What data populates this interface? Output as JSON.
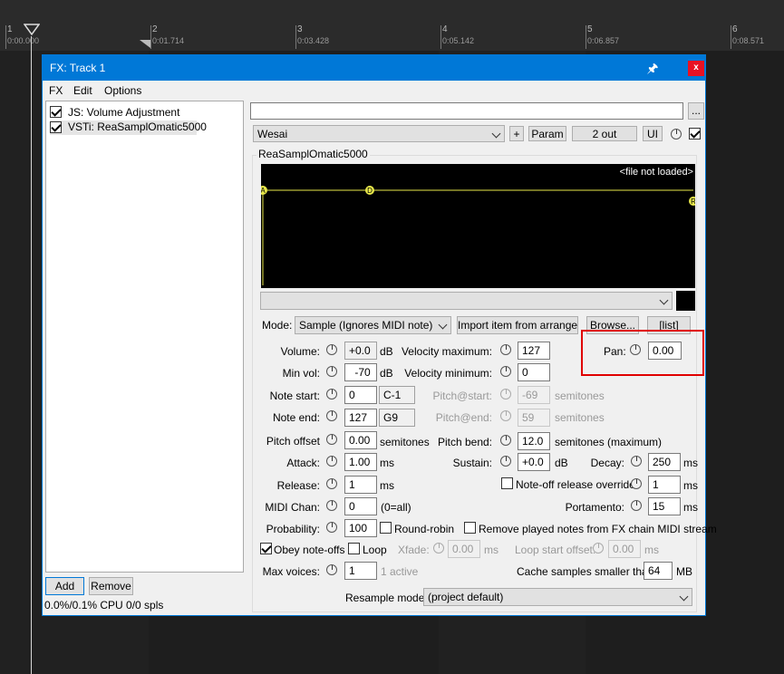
{
  "timeline": {
    "markers": [
      {
        "bar": "1",
        "time": "0:00.000"
      },
      {
        "bar": "2",
        "time": "0:01.714"
      },
      {
        "bar": "3",
        "time": "0:03.428"
      },
      {
        "bar": "4",
        "time": "0:05.142"
      },
      {
        "bar": "5",
        "time": "0:06.857"
      },
      {
        "bar": "6",
        "time": "0:08.571"
      }
    ]
  },
  "window": {
    "title": "FX: Track 1",
    "close_label": "x",
    "pin_icon": "pin-icon"
  },
  "menu": {
    "fx": "FX",
    "edit": "Edit",
    "options": "Options"
  },
  "fx_list": {
    "items": [
      {
        "label": "JS: Volume Adjustment",
        "enabled": true
      },
      {
        "label": "VSTi: ReaSamplOmatic5000",
        "enabled": true,
        "selected": true
      }
    ],
    "add_label": "Add",
    "remove_label": "Remove",
    "cpu_status": "0.0%/0.1% CPU 0/0 spls"
  },
  "header": {
    "name_field": "",
    "browse_dots": "...",
    "preset": "Wesai",
    "plus_label": "+",
    "param_label": "Param",
    "out_label": "2 out",
    "ui_label": "UI"
  },
  "plugin": {
    "group_title": "ReaSamplOmatic5000",
    "wave_status": "<file not loaded>",
    "envelope_points": [
      "A",
      "D",
      "R"
    ],
    "file_combo": "",
    "mode_label": "Mode:",
    "mode_value": "Sample (Ignores MIDI note)",
    "import_label": "Import item from arrange",
    "browse_label": "Browse...",
    "list_label": "[list]",
    "volume_label": "Volume:",
    "volume_value": "+0.0",
    "volume_unit": "dB",
    "minvol_label": "Min vol:",
    "minvol_value": "-70",
    "minvol_unit": "dB",
    "velmax_label": "Velocity maximum:",
    "velmax_value": "127",
    "velmin_label": "Velocity minimum:",
    "velmin_value": "0",
    "pan_label": "Pan:",
    "pan_value": "0.00",
    "notestart_label": "Note start:",
    "notestart_value": "0",
    "notestart_name": "C-1",
    "noteend_label": "Note end:",
    "noteend_value": "127",
    "noteend_name": "G9",
    "pitchstart_label": "Pitch@start:",
    "pitchstart_value": "-69",
    "pitchstart_unit": "semitones",
    "pitchend_label": "Pitch@end:",
    "pitchend_value": "59",
    "pitchend_unit": "semitones",
    "pitchoffset_label": "Pitch offset",
    "pitchoffset_value": "0.00",
    "pitchoffset_unit": "semitones",
    "pitchbend_label": "Pitch bend:",
    "pitchbend_value": "12.0",
    "pitchbend_unit": "semitones (maximum)",
    "attack_label": "Attack:",
    "attack_value": "1.00",
    "attack_unit": "ms",
    "sustain_label": "Sustain:",
    "sustain_value": "+0.0",
    "sustain_unit": "dB",
    "decay_label": "Decay:",
    "decay_value": "250",
    "decay_unit": "ms",
    "release_label": "Release:",
    "release_value": "1",
    "release_unit": "ms",
    "noteoff_label": "Note-off release override:",
    "noteoff_value": "1",
    "noteoff_unit": "ms",
    "midichan_label": "MIDI Chan:",
    "midichan_value": "0",
    "midichan_note": "(0=all)",
    "portamento_label": "Portamento:",
    "portamento_value": "15",
    "portamento_unit": "ms",
    "probability_label": "Probability:",
    "probability_value": "100",
    "roundrobin_label": "Round-robin",
    "removeplayed_label": "Remove played notes from FX chain MIDI stream",
    "obey_label": "Obey note-offs",
    "loop_label": "Loop",
    "xfade_label": "Xfade:",
    "xfade_value": "0.00",
    "xfade_unit": "ms",
    "loopstart_label": "Loop start offset:",
    "loopstart_value": "0.00",
    "loopstart_unit": "ms",
    "maxvoices_label": "Max voices:",
    "maxvoices_value": "1",
    "maxvoices_status": "1 active",
    "cache_label": "Cache samples smaller than:",
    "cache_value": "64",
    "cache_unit": "MB",
    "resample_label": "Resample mode:",
    "resample_value": "(project default)"
  },
  "colors": {
    "titlebar": "#0078d7",
    "highlight": "#e00000",
    "envelope": "#e8e84a"
  }
}
